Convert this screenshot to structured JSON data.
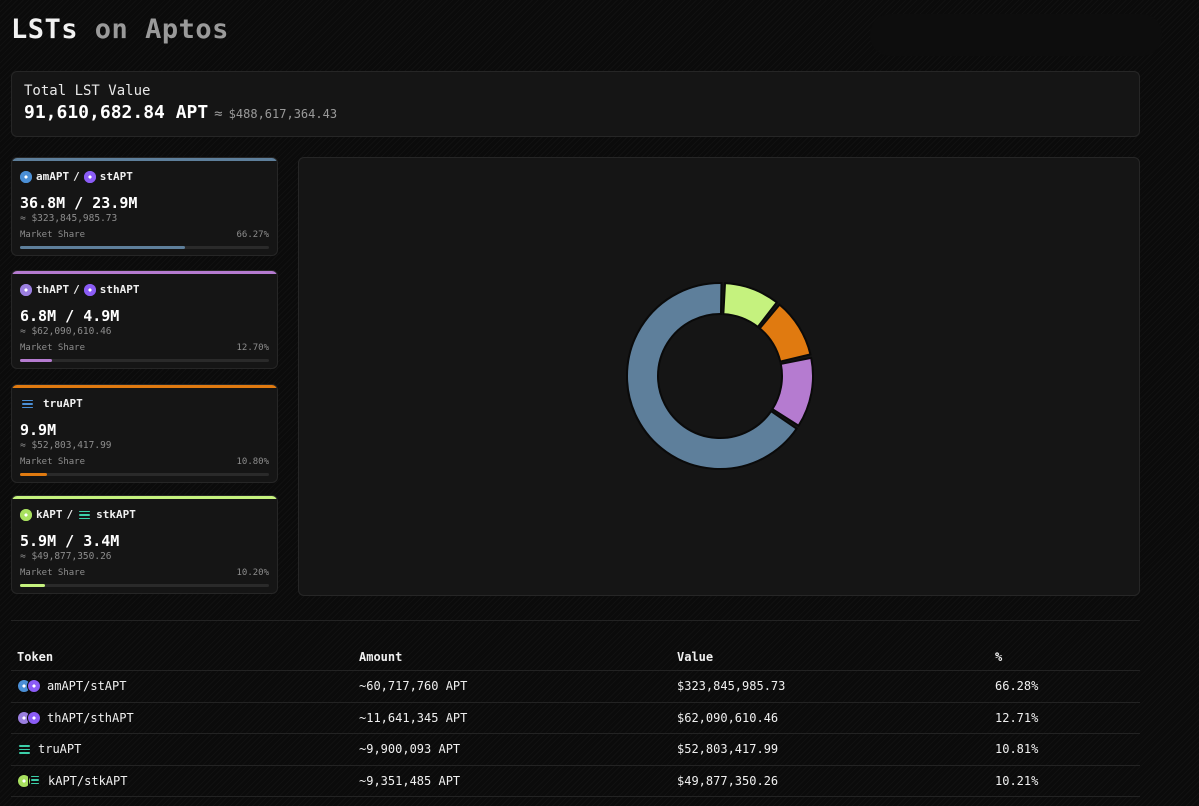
{
  "header": {
    "title_main": "LSTs",
    "title_sub": "on Aptos"
  },
  "total": {
    "label": "Total LST Value",
    "apt": "91,610,682.84 APT",
    "approx": "≈",
    "usd": "$488,617,364.43"
  },
  "colors": {
    "amAPT": "#5e7f9b",
    "thAPT": "#b57bd0",
    "truAPT": "#e07a10",
    "kAPT": "#c5f27e",
    "am_icon": "#4b8fd6",
    "st_icon": "#8b5cf6",
    "tru_icon": "#3ccfa9"
  },
  "cards": [
    {
      "name1": "amAPT",
      "sep": "/",
      "name2": "stAPT",
      "amount": "36.8M / 23.9M",
      "usd": "≈ $323,845,985.73",
      "ms_label": "Market Share",
      "ms_pct": "66.27%",
      "share": 66.27,
      "color": "#5e7f9b",
      "icon1": "#4b8fd6",
      "icon2": "#8b5cf6"
    },
    {
      "name1": "thAPT",
      "sep": "/",
      "name2": "sthAPT",
      "amount": "6.8M / 4.9M",
      "usd": "≈ $62,090,610.46",
      "ms_label": "Market Share",
      "ms_pct": "12.70%",
      "share": 12.7,
      "color": "#b57bd0",
      "icon1": "#9b7fe0",
      "icon2": "#8b5cf6"
    },
    {
      "name1": "truAPT",
      "sep": "",
      "name2": "",
      "amount": "9.9M",
      "usd": "≈ $52,803,417.99",
      "ms_label": "Market Share",
      "ms_pct": "10.80%",
      "share": 10.8,
      "color": "#e07a10",
      "icon1": "#3ccfa9",
      "icon2": ""
    },
    {
      "name1": "kAPT",
      "sep": "/",
      "name2": "stkAPT",
      "amount": "5.9M / 3.4M",
      "usd": "≈ $49,877,350.26",
      "ms_label": "Market Share",
      "ms_pct": "10.20%",
      "share": 10.2,
      "color": "#c5f27e",
      "icon1": "#a8e05f",
      "icon2": "#3ccfa9"
    }
  ],
  "chart_data": {
    "type": "pie",
    "donut": true,
    "categories": [
      "amAPT/stAPT",
      "thAPT/sthAPT",
      "truAPT",
      "kAPT/stkAPT"
    ],
    "values": [
      66.28,
      12.71,
      10.81,
      10.21
    ],
    "colors": [
      "#5e7f9b",
      "#b57bd0",
      "#e07a10",
      "#c5f27e"
    ],
    "legend": "none"
  },
  "table": {
    "headers": [
      "Token",
      "Amount",
      "Value",
      "%"
    ],
    "rows": [
      {
        "token": "amAPT/stAPT",
        "amount": "~60,717,760 APT",
        "value": "$323,845,985.73",
        "pct": "66.28%"
      },
      {
        "token": "thAPT/sthAPT",
        "amount": "~11,641,345 APT",
        "value": "$62,090,610.46",
        "pct": "12.71%"
      },
      {
        "token": "truAPT",
        "amount": "~9,900,093 APT",
        "value": "$52,803,417.99",
        "pct": "10.81%"
      },
      {
        "token": "kAPT/stkAPT",
        "amount": "~9,351,485 APT",
        "value": "$49,877,350.26",
        "pct": "10.21%"
      }
    ]
  }
}
